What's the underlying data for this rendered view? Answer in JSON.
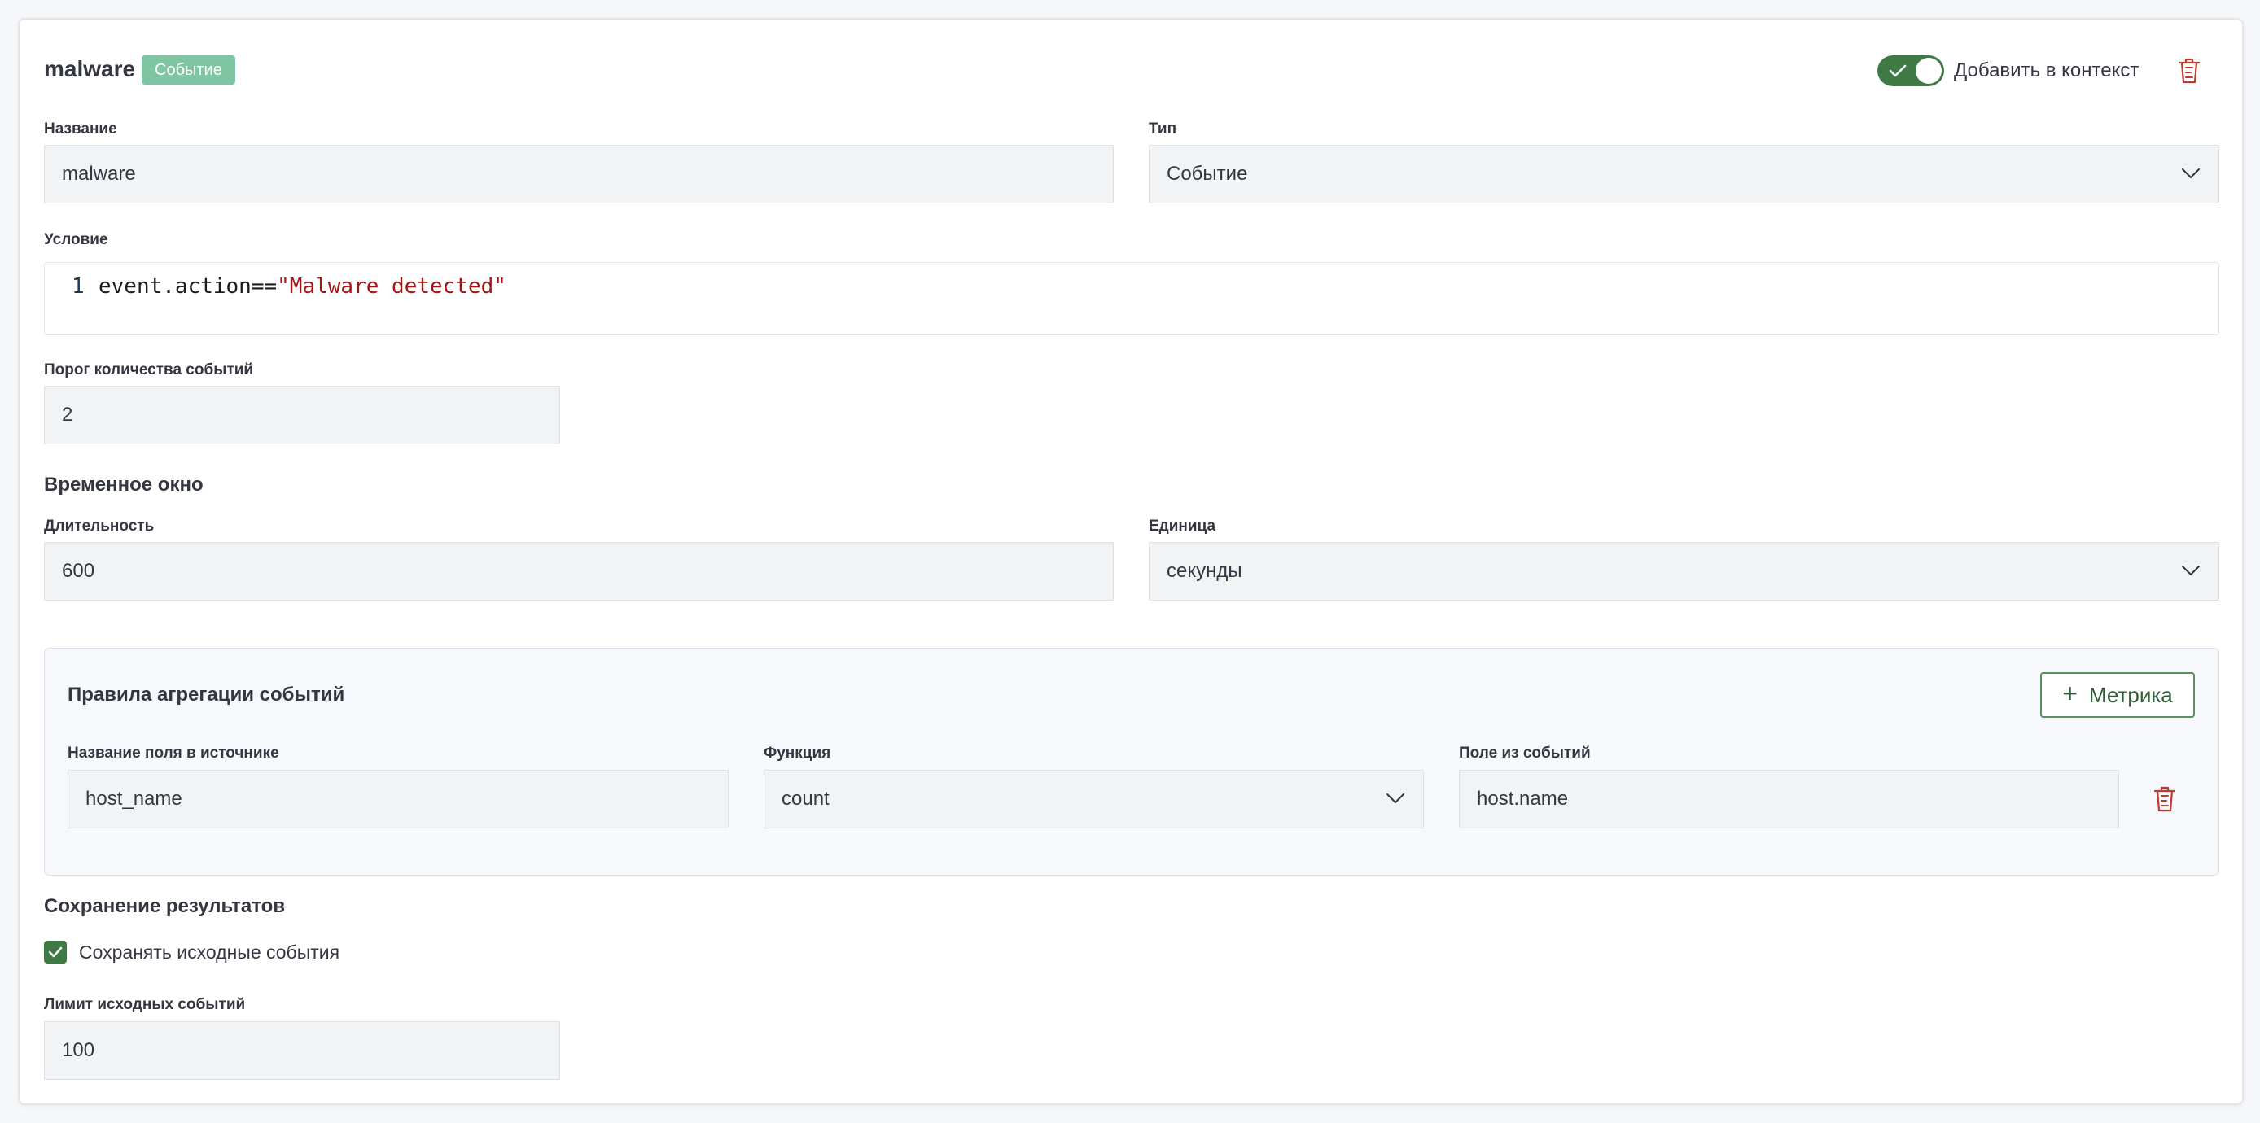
{
  "header": {
    "title": "malware",
    "badge": "Событие",
    "toggle_label": "Добавить в контекст",
    "toggle_on": true,
    "delete_icon": "trash-icon"
  },
  "form": {
    "name_label": "Название",
    "name_value": "malware",
    "type_label": "Тип",
    "type_value": "Событие",
    "condition_label": "Условие",
    "condition_line_number": "1",
    "condition_code": "event.action==",
    "condition_string": "\"Malware detected\"",
    "threshold_label": "Порог количества событий",
    "threshold_value": "2",
    "time_window_title": "Временное окно",
    "duration_label": "Длительность",
    "duration_value": "600",
    "unit_label": "Единица",
    "unit_value": "секунды"
  },
  "aggregation": {
    "title": "Правила агрегации событий",
    "add_metric_label": "Метрика",
    "source_field_label": "Название поля в источнике",
    "source_field_value": "host_name",
    "function_label": "Функция",
    "function_value": "count",
    "event_field_label": "Поле из событий",
    "event_field_value": "host.name"
  },
  "results": {
    "title": "Сохранение результатов",
    "save_events_label": "Сохранять исходные события",
    "save_events_checked": true,
    "limit_label": "Лимит исходных событий",
    "limit_value": "100"
  },
  "colors": {
    "accent_green": "#3f7a45",
    "badge_green": "#7fc5a3",
    "delete_red": "#c0392b",
    "string_red": "#a31515"
  }
}
